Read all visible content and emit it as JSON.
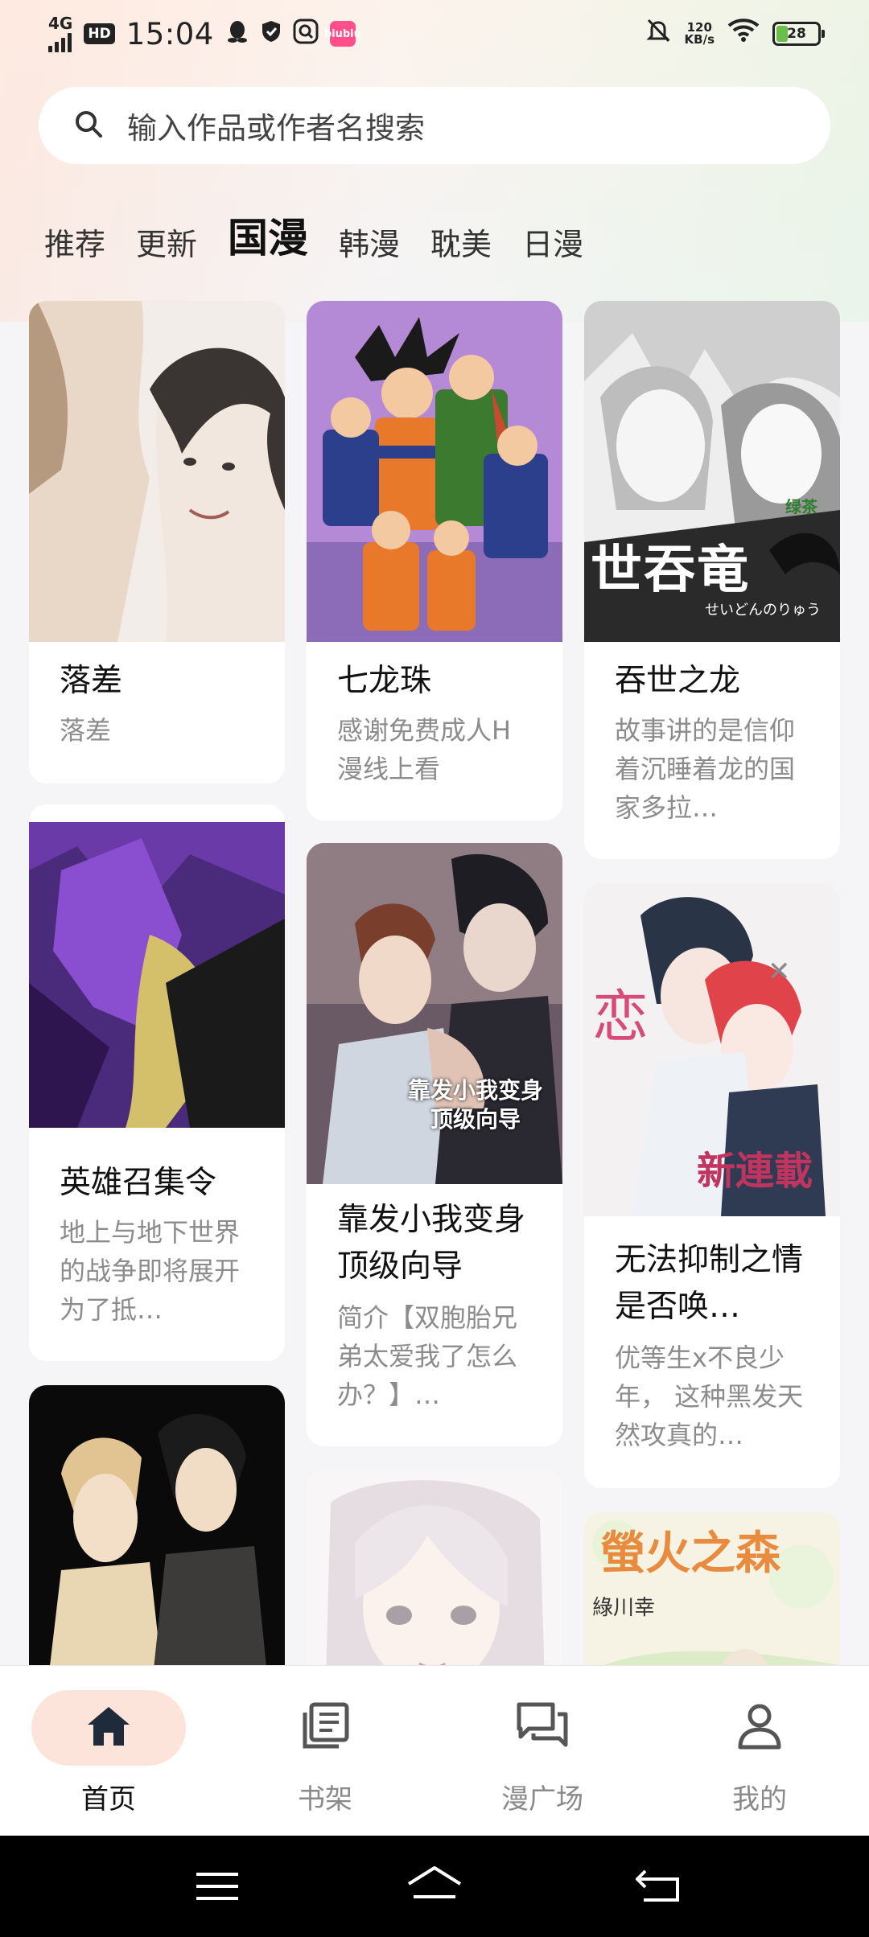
{
  "status_bar": {
    "network": "4G",
    "hd": "HD",
    "time": "15:04",
    "app_badge": "biubiu",
    "speed_value": "120",
    "speed_unit": "KB/s",
    "battery": "28"
  },
  "search": {
    "placeholder": "输入作品或作者名搜索"
  },
  "tabs": [
    {
      "label": "推荐",
      "active": false
    },
    {
      "label": "更新",
      "active": false
    },
    {
      "label": "国漫",
      "active": true
    },
    {
      "label": "韩漫",
      "active": false
    },
    {
      "label": "耽美",
      "active": false
    },
    {
      "label": "日漫",
      "active": false
    }
  ],
  "cards": [
    {
      "title": "落差",
      "desc": "落差",
      "cover_colors": [
        "#f3ede9",
        "#d9c8bb",
        "#3a3533"
      ]
    },
    {
      "title": "七龙珠",
      "desc": "感谢免费成人H漫线上看",
      "cover_colors": [
        "#b48ad6",
        "#e9792a",
        "#3c7a2f"
      ]
    },
    {
      "title": "吞世之龙",
      "desc": "故事讲的是信仰着沉睡着龙的国家多拉…",
      "cover_colors": [
        "#eeeeee",
        "#9a9a9a",
        "#222222"
      ]
    },
    {
      "title": "英雄召集令",
      "desc": "地上与地下世界的战争即将展开 为了抵…",
      "cover_colors": [
        "#4a2a7a",
        "#8a4fd0",
        "#1a1a1a"
      ]
    },
    {
      "title": "靠发小我变身顶级向导",
      "desc": "简介【双胞胎兄弟太爱我了怎么办？】…",
      "cover_colors": [
        "#6a5a66",
        "#c9a28a",
        "#1f1d24"
      ]
    },
    {
      "title": "无法抑制之情是否唤…",
      "desc": "优等生x不良少年， 这种黑发天然攻真的…",
      "cover_colors": [
        "#f4f1f2",
        "#e0444a",
        "#2a3447"
      ]
    },
    {
      "title": "",
      "desc": "",
      "cover_colors": [
        "#0a0a0a",
        "#e9d7b3",
        "#3d3a3a"
      ]
    },
    {
      "title": "",
      "desc": "",
      "cover_colors": [
        "#f8f6f7",
        "#e5dde2",
        "#a9a0a6"
      ]
    },
    {
      "title": "",
      "desc": "",
      "cover_colors": [
        "#f7f3e4",
        "#8fc06a",
        "#e88b3e"
      ]
    }
  ],
  "cover_text": {
    "card2_title": "世吞竜",
    "card2_sub": "せいどんのりゅう",
    "card2_brand": "绿茶",
    "card5_text": "靠发小我变身顶级向导",
    "card6_text": "新連載",
    "card9_title": "螢火之森",
    "card9_author": "綠川幸"
  },
  "bottom_nav": [
    {
      "label": "首页",
      "icon": "home-icon",
      "active": true
    },
    {
      "label": "书架",
      "icon": "bookshelf-icon",
      "active": false
    },
    {
      "label": "漫广场",
      "icon": "chat-icon",
      "active": false
    },
    {
      "label": "我的",
      "icon": "profile-icon",
      "active": false
    }
  ],
  "colors": {
    "accent": "#f26b3a",
    "active_pill": "#fde4da",
    "text_muted": "#8c8c8c"
  }
}
